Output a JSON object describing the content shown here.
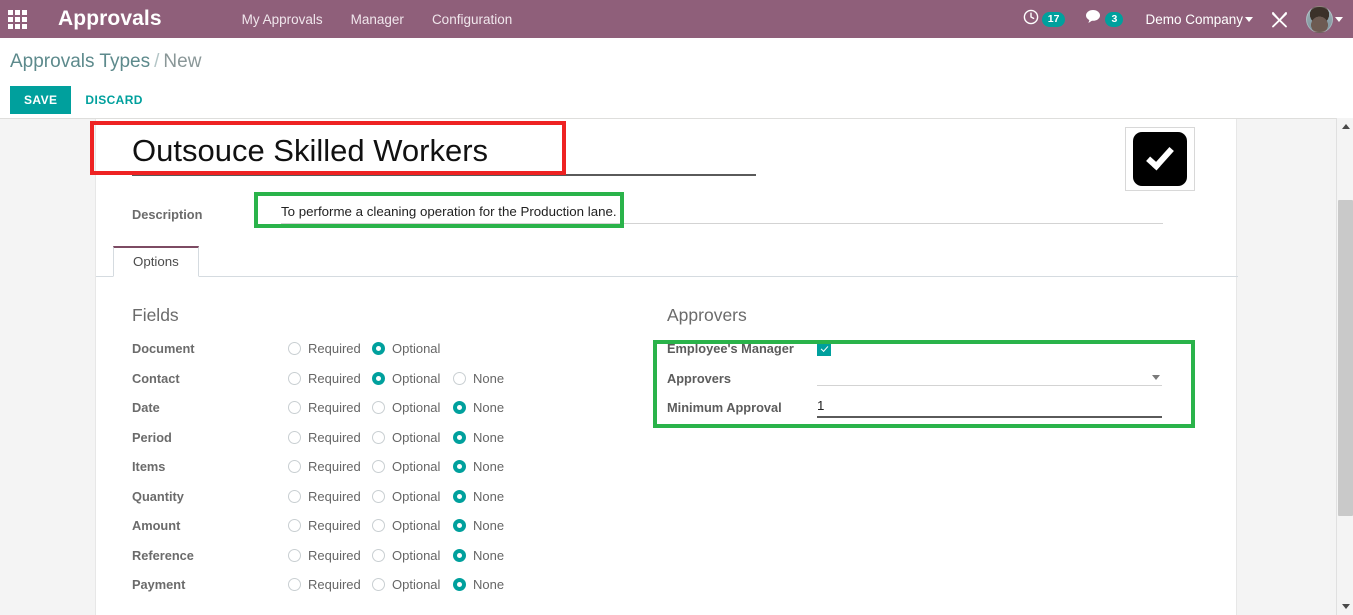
{
  "navbar": {
    "apps_icon": "apps-grid-icon",
    "brand": "Approvals",
    "menus": [
      {
        "label": "My Approvals"
      },
      {
        "label": "Manager"
      },
      {
        "label": "Configuration"
      }
    ],
    "activity_icon": "clock-icon",
    "activity_count": "17",
    "messages_icon": "chat-bubble-icon",
    "messages_count": "3",
    "company": "Demo Company",
    "tools_icon": "wrench-screwdriver-icon",
    "avatar_icon": "user-avatar"
  },
  "control_panel": {
    "breadcrumb_root": "Approvals Types",
    "breadcrumb_sep": "/",
    "breadcrumb_current": "New",
    "save_label": "SAVE",
    "discard_label": "DISCARD"
  },
  "form": {
    "title": "Outsouce Skilled Workers",
    "image_icon": "checkmark-image",
    "description_label": "Description",
    "description_value": "To performe a cleaning operation for the Production lane.",
    "tabs": [
      {
        "label": "Options",
        "active": true
      }
    ],
    "fields_group_title": "Fields",
    "approvers_group_title": "Approvers",
    "radio_labels": {
      "required": "Required",
      "optional": "Optional",
      "none": "None"
    },
    "fields_rows": [
      {
        "label": "Document",
        "selected": "optional",
        "has_none": false
      },
      {
        "label": "Contact",
        "selected": "optional",
        "has_none": true
      },
      {
        "label": "Date",
        "selected": "none",
        "has_none": true
      },
      {
        "label": "Period",
        "selected": "none",
        "has_none": true
      },
      {
        "label": "Items",
        "selected": "none",
        "has_none": true
      },
      {
        "label": "Quantity",
        "selected": "none",
        "has_none": true
      },
      {
        "label": "Amount",
        "selected": "none",
        "has_none": true
      },
      {
        "label": "Reference",
        "selected": "none",
        "has_none": true
      },
      {
        "label": "Payment",
        "selected": "none",
        "has_none": true
      }
    ],
    "approvers": {
      "manager_label": "Employee's Manager",
      "manager_checked": true,
      "approvers_label": "Approvers",
      "approvers_value": "",
      "minimum_label": "Minimum Approval",
      "minimum_value": "1"
    }
  },
  "annotations": [
    {
      "name": "title-highlight",
      "color": "#ee2222"
    },
    {
      "name": "description-highlight",
      "color": "#2ab34a"
    },
    {
      "name": "approvers-highlight",
      "color": "#2ab34a"
    }
  ],
  "scrollbar": {
    "up_icon": "chevron-up-icon",
    "down_icon": "chevron-down-icon"
  }
}
